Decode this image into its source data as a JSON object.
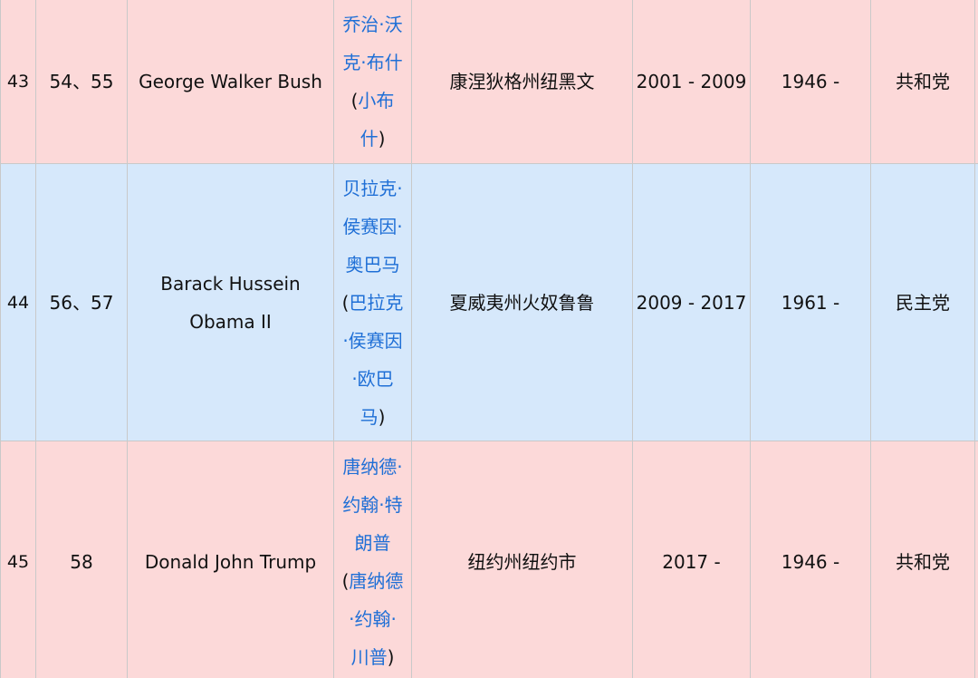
{
  "rows": [
    {
      "order": "43",
      "terms": "54、55",
      "name_en": "George Walker Bush",
      "name_cn": "乔治·沃克·布什",
      "alias_cn": "小布什",
      "birthplace": "康涅狄格州纽黑文",
      "tenure": "2001 - 2009",
      "born": "1946 -",
      "party": "共和党"
    },
    {
      "order": "44",
      "terms": "56、57",
      "name_en": "Barack Hussein Obama II",
      "name_cn": "贝拉克·侯赛因·奥巴马",
      "alias_cn": "巴拉克·侯赛因·欧巴马",
      "birthplace": "夏威夷州火奴鲁鲁",
      "tenure": "2009 - 2017",
      "born": "1961 -",
      "party": "民主党"
    },
    {
      "order": "45",
      "terms": "58",
      "name_en": "Donald John Trump",
      "name_cn": "唐纳德·约翰·特朗普",
      "alias_cn": "唐纳德·约翰·川普",
      "birthplace": "纽约州纽约市",
      "tenure": "2017 -",
      "born": "1946 -",
      "party": "共和党"
    }
  ],
  "colors": {
    "republican_bg": "#fcd9d9",
    "democrat_bg": "#d6e8fb",
    "link": "#1f6fd6",
    "border": "#c9c9c9"
  },
  "paren_open": "(",
  "paren_close": ")"
}
